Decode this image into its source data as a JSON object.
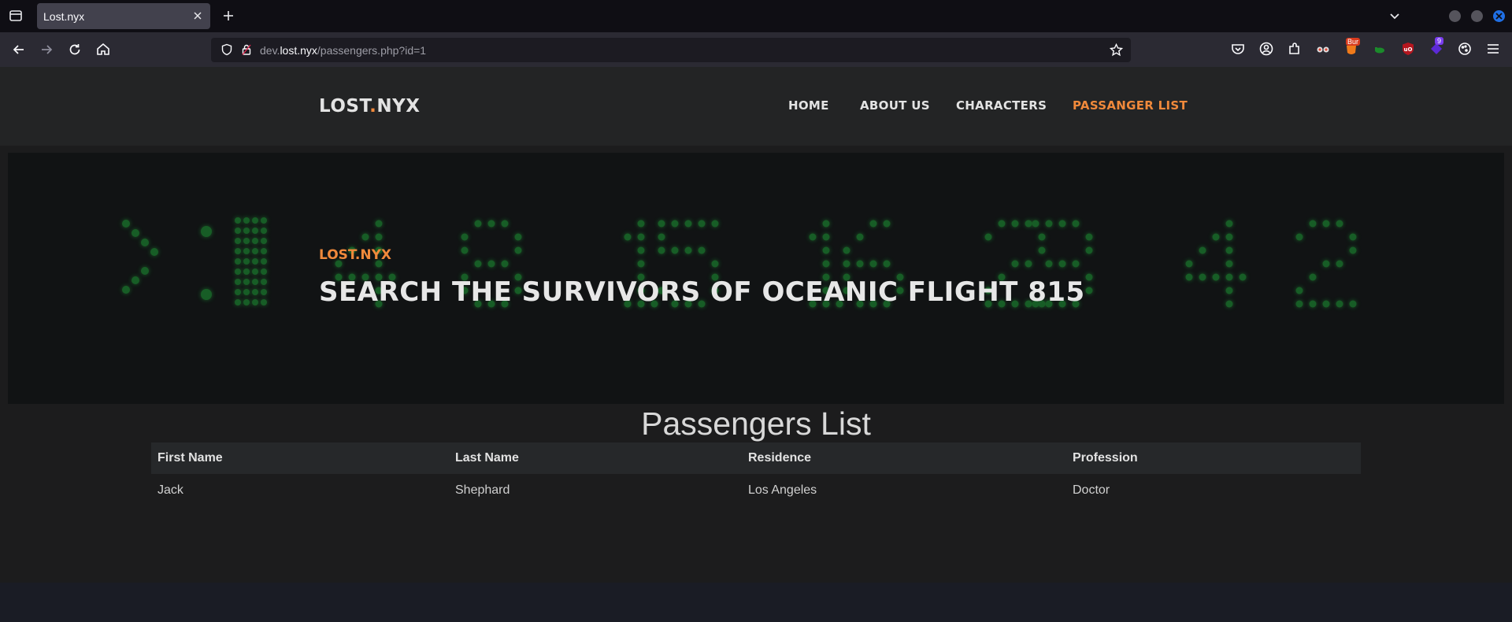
{
  "browser": {
    "tab_title": "Lost.nyx",
    "url_prefix": "dev.",
    "url_host": "lost.nyx",
    "url_path": "/passengers.php?id=1",
    "ext_badge_text": "Bur",
    "ext_badge_count": "9"
  },
  "site": {
    "logo_left": "LOST",
    "logo_dot": ".",
    "logo_right": "NYX",
    "nav": [
      "HOME",
      "ABOUT US",
      "CHARACTERS",
      "PASSANGER LIST"
    ],
    "hero_eyebrow": "LOST.NYX",
    "hero_title": "SEARCH THE SURVIVORS OF OCEANIC FLIGHT 815",
    "list_title": "Passengers List",
    "table": {
      "headers": [
        "First Name",
        "Last Name",
        "Residence",
        "Profession"
      ],
      "rows": [
        [
          "Jack",
          "Shephard",
          "Los Angeles",
          "Doctor"
        ]
      ]
    }
  },
  "colors": {
    "accent": "#f0893b",
    "led_green": "#1f9a34"
  }
}
